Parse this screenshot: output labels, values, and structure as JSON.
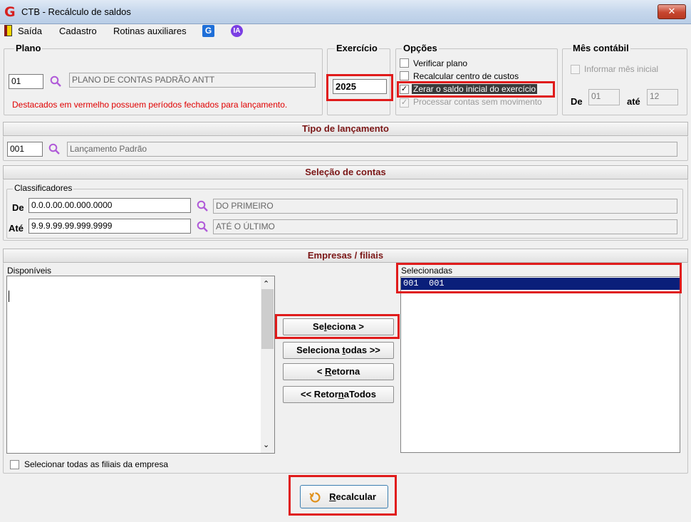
{
  "window": {
    "title": "CTB - Recálculo de saldos",
    "close_label": "✕",
    "logo": "G"
  },
  "menu": {
    "items": [
      "Saída",
      "Cadastro",
      "Rotinas auxiliares"
    ],
    "icon_g": "G",
    "icon_ia": "IA"
  },
  "plano": {
    "legend": "Plano",
    "code": "01",
    "name": "PLANO DE CONTAS PADRÃO ANTT",
    "note": "Destacados em vermelho possuem períodos fechados para lançamento."
  },
  "exercicio": {
    "legend": "Exercício",
    "value": "2025"
  },
  "opcoes": {
    "legend": "Opções",
    "items": [
      {
        "label": "Verificar plano",
        "checked": false,
        "enabled": true
      },
      {
        "label": "Recalcular centro de custos",
        "checked": false,
        "enabled": true
      },
      {
        "label": "Zerar o saldo inicial do exercício",
        "checked": true,
        "enabled": true
      },
      {
        "label": "Processar contas sem movimento",
        "checked": true,
        "enabled": false
      }
    ]
  },
  "mes_contabil": {
    "legend": "Mês contábil",
    "informar_label": "Informar mês inicial",
    "de_label": "De",
    "de_value": "01",
    "ate_label": "até",
    "ate_value": "12"
  },
  "tipo_lancamento": {
    "header": "Tipo de lançamento",
    "code": "001",
    "name": "Lançamento Padrão"
  },
  "selecao_contas": {
    "header": "Seleção de contas",
    "legend": "Classificadores",
    "de_label": "De",
    "de_value": "0.0.0.00.00.000.0000",
    "de_desc": "DO PRIMEIRO",
    "ate_label": "Até",
    "ate_value": "9.9.9.99.99.999.9999",
    "ate_desc": "ATÉ O ÚLTIMO"
  },
  "empresas": {
    "header": "Empresas / filiais",
    "disponiveis_label": "Disponíveis",
    "selecionadas_label": "Selecionadas",
    "selecionadas_items": [
      "001  001"
    ],
    "select_all_label": "Selecionar todas as filiais da empresa"
  },
  "buttons": {
    "seleciona": {
      "before": "Se",
      "underline": "l",
      "after": "eciona >"
    },
    "seleciona_todas": {
      "before": "Seleciona ",
      "underline": "t",
      "after": "odas >>"
    },
    "retorna": {
      "before": "< ",
      "underline": "R",
      "after": "etorna"
    },
    "retorna_todos": {
      "before": "<< Retor",
      "underline": "n",
      "after": "aTodos"
    },
    "recalcular": {
      "before": "",
      "underline": "R",
      "after": "ecalcular"
    }
  },
  "colors": {
    "highlight_red": "#e01b1b",
    "section_title": "#7b1616",
    "selection_bg": "#0a1f7a",
    "accent_purple": "#b05ad8"
  }
}
